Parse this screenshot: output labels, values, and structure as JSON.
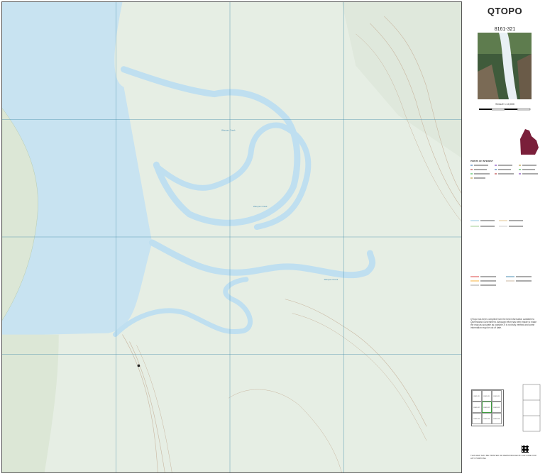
{
  "brand": "QTOPO",
  "sheet_number": "8161-321",
  "scale_label": "SCALE 1:10,000",
  "map_labels": {
    "creek_1": "Wanyan Creek",
    "creek_2": "Wanyan Creek",
    "creek_3": "Wanyan Creek"
  },
  "legend_heading": "POINTS OF INTEREST",
  "disclaimer": "QTopo has been compiled from the best information available to Queensland Government. Although effort has been made to make the map as accurate as possible, it is not fully verified and some information may be out of date.",
  "footer_text": "THIS MAP MAY BE PRINTED OR REPRODUCED BY ANYONE FOR ANY PURPOSE",
  "index_sheets": [
    "8161-311",
    "8161-312",
    "8161-313",
    "8161-321",
    "8161-322",
    "8161-323",
    "8161-331",
    "8161-332",
    "8161-333"
  ],
  "colors": {
    "water": "#c8e3f1",
    "river": "#bfdff0",
    "land": "#e6eee4",
    "flat": "#eef3e8",
    "contour": "#c9b7a1",
    "grid": "#3f8aa8"
  }
}
